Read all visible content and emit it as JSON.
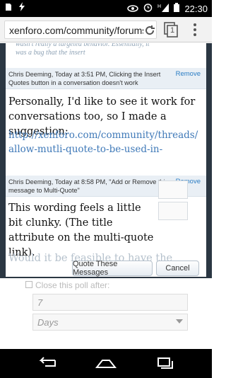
{
  "status_bar": {
    "time": "22:30",
    "left_icons": [
      "sd-card-icon",
      "lightning-icon"
    ],
    "right_icons": [
      "eye-icon",
      "alarm-icon",
      "signal-icon",
      "battery-icon"
    ],
    "network": "H"
  },
  "browser": {
    "url": "xenforo.com/community/forums",
    "tab_count": "1"
  },
  "dialog": {
    "top_fragment": "wasn't really a targeted behavior. Essentially, it was a bug that the insert",
    "messages": [
      {
        "header": "Chris Deeming, Today at 3:51 PM, Clicking the Insert Quotes button in a conversation doesn't work",
        "remove_label": "Remove",
        "body": "Personally, I'd like to see it work for conversations too, so I made a suggestion:",
        "link": "http://xenforo.com/community/threads/allow-mutli-quote-to-be-used-in-"
      },
      {
        "header": "Chris Deeming, Today at 8:58 PM, \"Add or Remove this message to Multi-Quote\"",
        "remove_label": "Remove",
        "body": "This wording feels a little bit clunky. (The title attribute on the multi-quote link).",
        "faded_body": "Would it be feasible to have the"
      }
    ],
    "quote_button_label": "Quote These Messages",
    "cancel_button_label": "Cancel"
  },
  "background_form": {
    "close_poll_label": "Close this poll after:",
    "close_poll_value": "7",
    "period_value": "Days"
  },
  "nav_bar": {
    "icons": [
      "back-icon",
      "home-icon",
      "recent-apps-icon"
    ]
  }
}
